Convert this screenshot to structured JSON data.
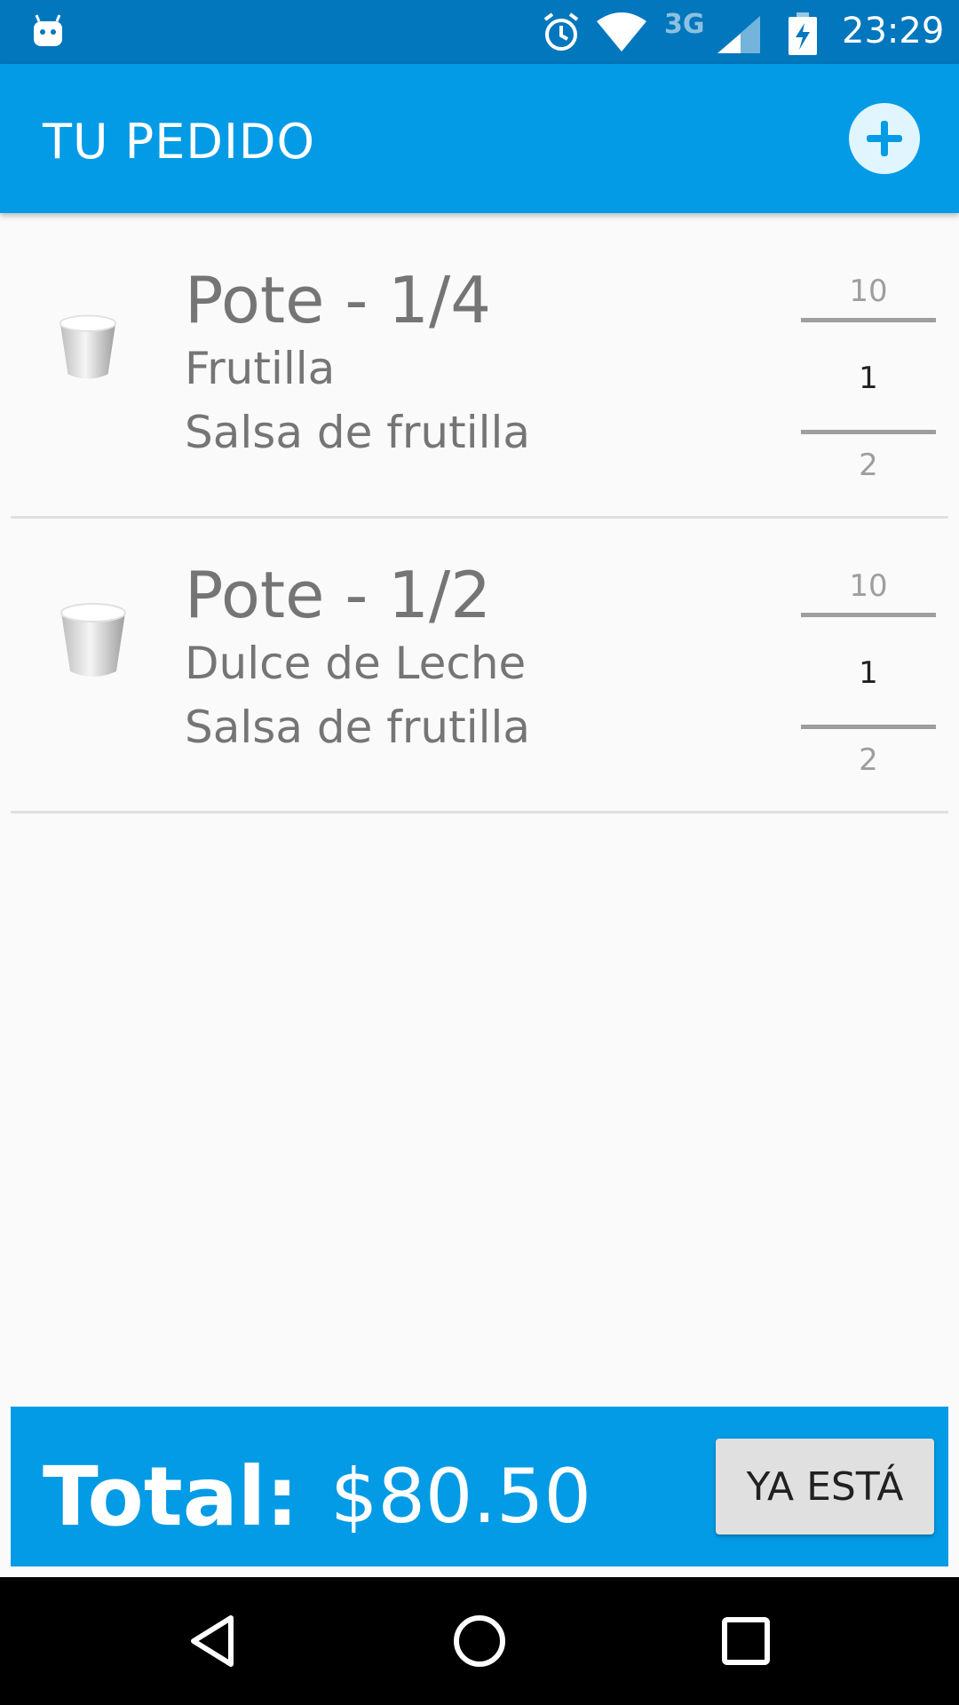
{
  "status_bar": {
    "time": "23:29",
    "network_type": "3G",
    "icons": [
      "android-notification-icon",
      "alarm-icon",
      "wifi-icon",
      "signal-icon",
      "battery-charging-icon"
    ]
  },
  "app_bar": {
    "title": "TU PEDIDO",
    "add_icon": "plus-icon"
  },
  "order_items": [
    {
      "name": "Pote - 1/4",
      "flavor": "Frutilla",
      "sauce": "Salsa de frutilla",
      "quantity": {
        "above": "10",
        "current": "1",
        "below": "2"
      },
      "icon": "cup-icon"
    },
    {
      "name": "Pote - 1/2",
      "flavor": "Dulce de Leche",
      "sauce": "Salsa de frutilla",
      "quantity": {
        "above": "10",
        "current": "1",
        "below": "2"
      },
      "icon": "cup-icon"
    }
  ],
  "total_bar": {
    "label": "Total:",
    "value": "$80.50",
    "done_label": "YA ESTÁ"
  },
  "nav_bar": {
    "icons": [
      "back-icon",
      "home-icon",
      "recents-icon"
    ]
  },
  "colors": {
    "status_bar": "#0277bd",
    "primary": "#039be5",
    "background": "#fafafa"
  }
}
